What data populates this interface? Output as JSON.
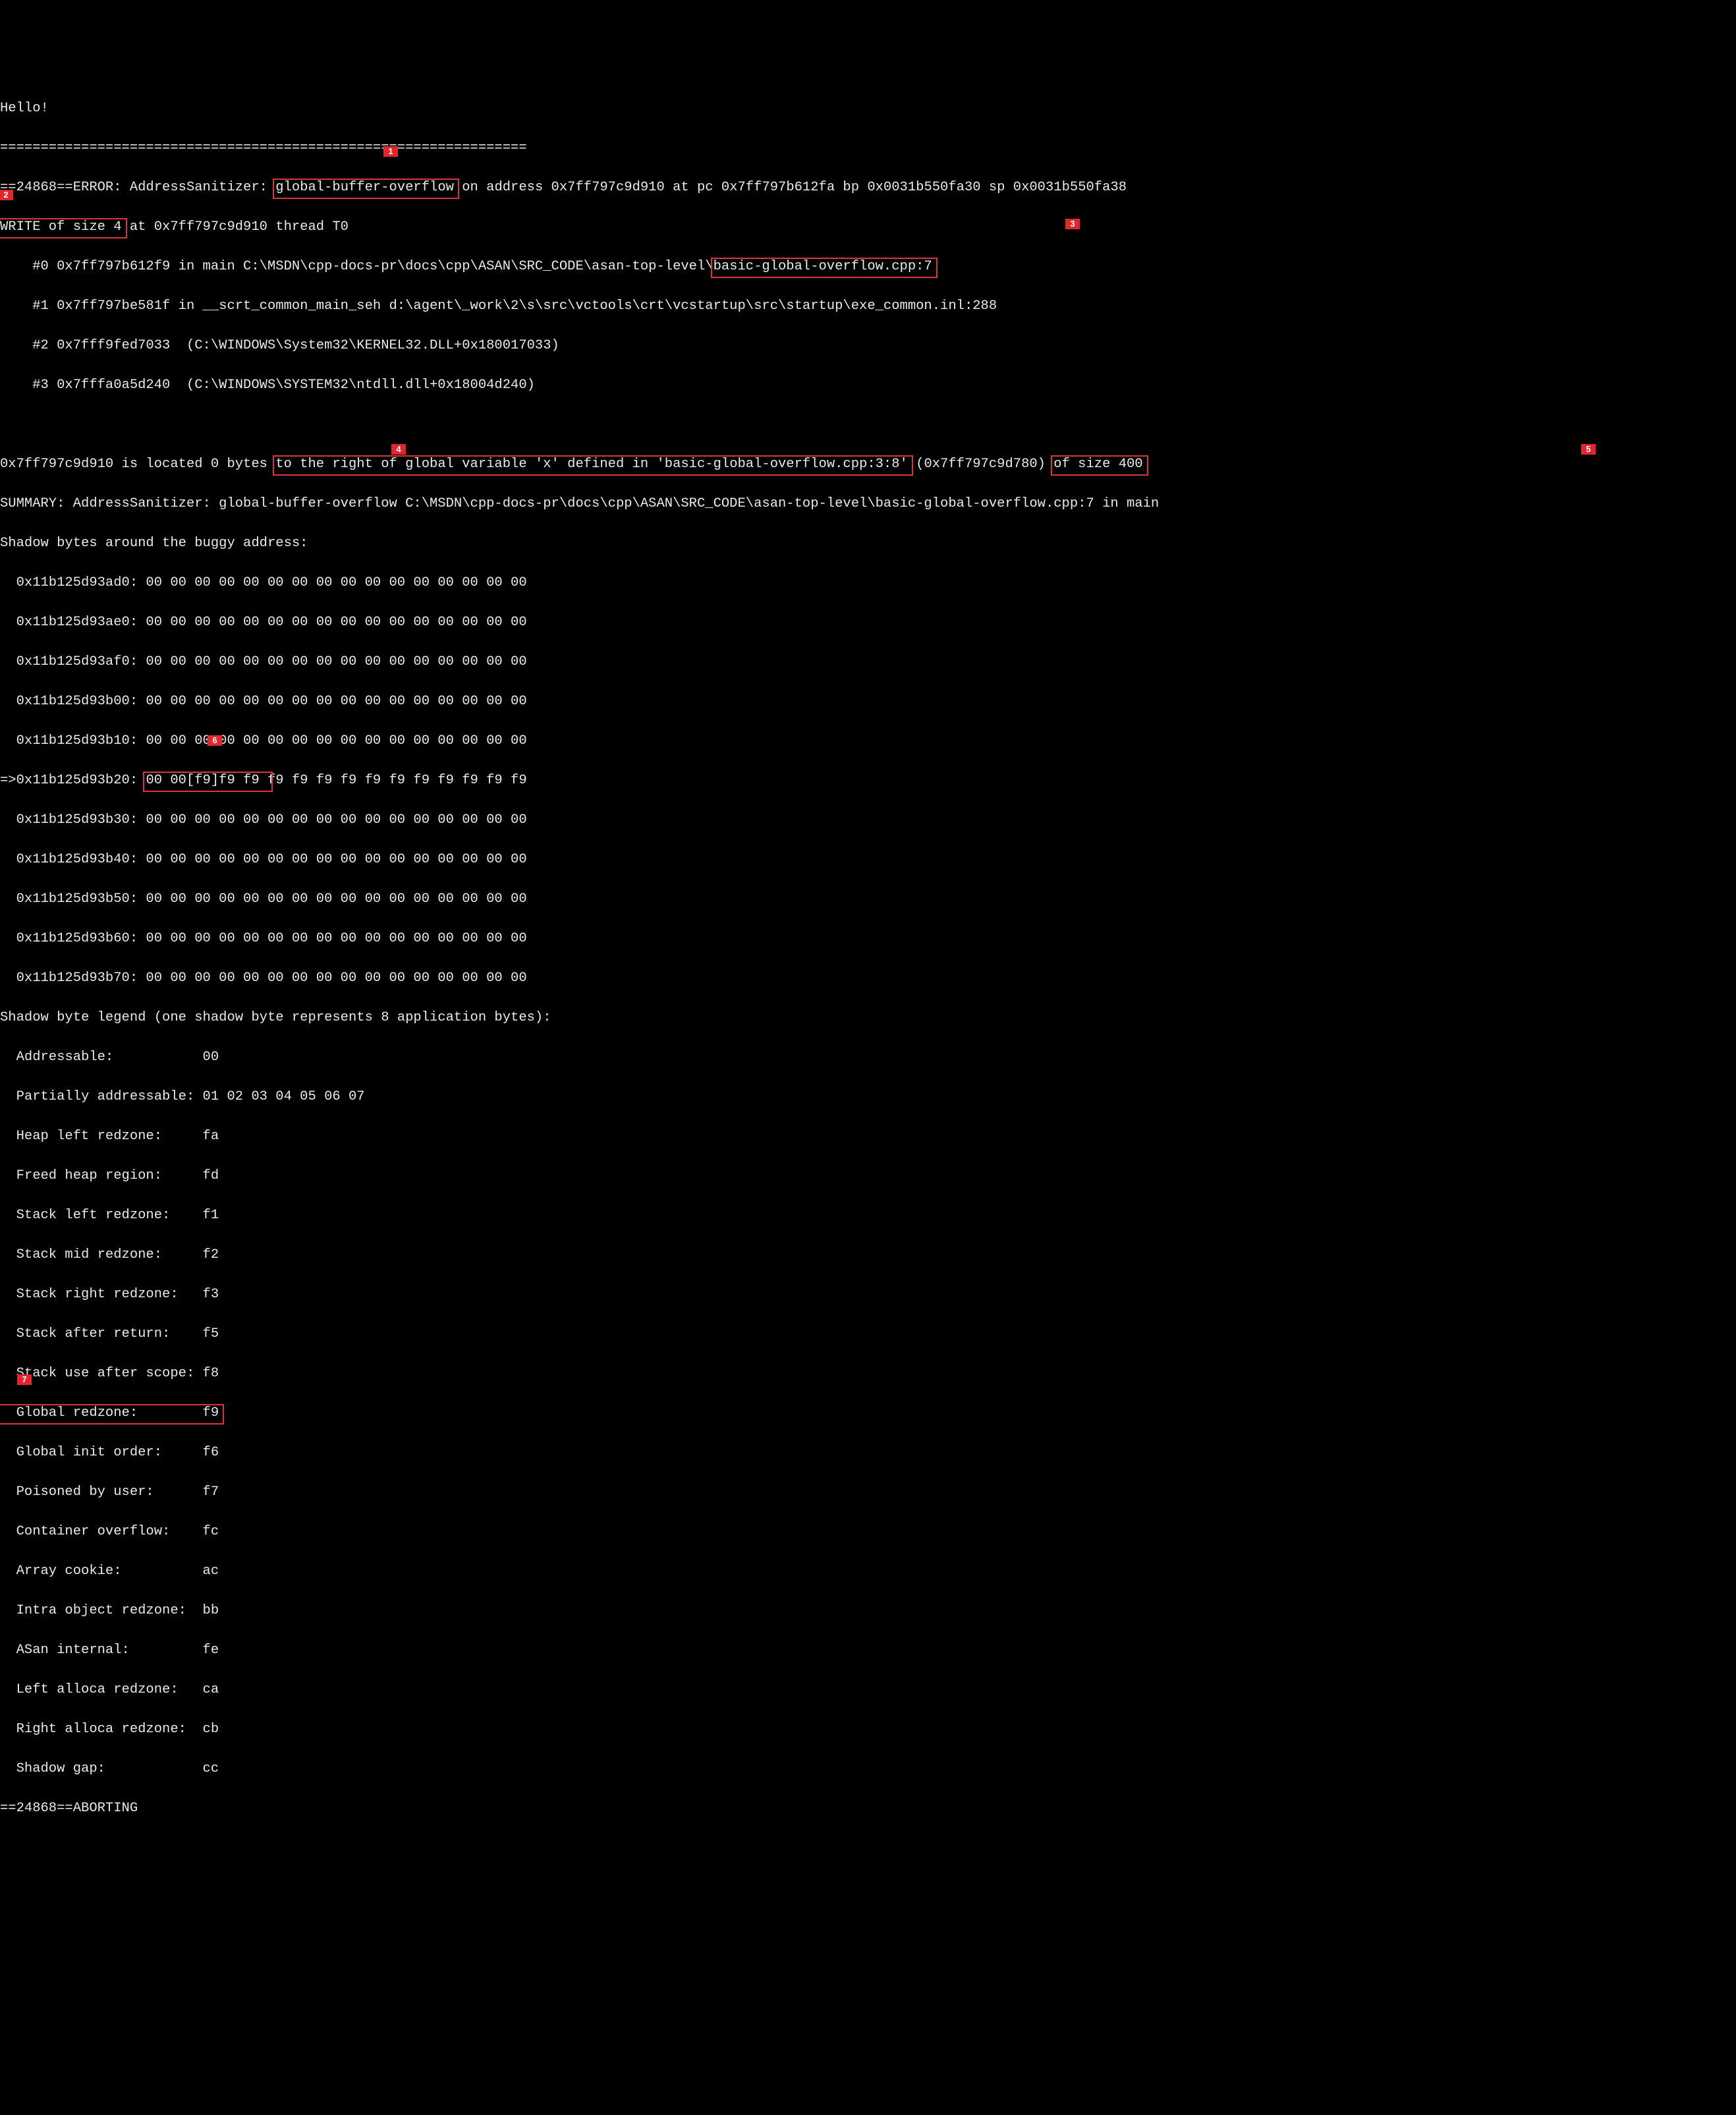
{
  "greeting": "Hello!",
  "divider": "=================================================================",
  "error": {
    "prefix": "==24868==ERROR: AddressSanitizer: ",
    "type": "global-buffer-overflow",
    "suffix": " on address 0x7ff797c9d910 at pc 0x7ff797b612fa bp 0x0031b550fa30 sp 0x0031b550fa38"
  },
  "write": {
    "prefix": "WRITE of size 4",
    "mid": " at 0x7ff797c9d910 thread T0"
  },
  "stack": {
    "f0a": "    #0 0x7ff797b612f9 in main C:\\MSDN\\cpp-docs-pr\\docs\\cpp\\ASAN\\SRC_CODE\\asan-top-level\\",
    "f0b": "basic-global-overflow.cpp:7",
    "f1": "    #1 0x7ff797be581f in __scrt_common_main_seh d:\\agent\\_work\\2\\s\\src\\vctools\\crt\\vcstartup\\src\\startup\\exe_common.inl:288",
    "f2": "    #2 0x7fff9fed7033  (C:\\WINDOWS\\System32\\KERNEL32.DLL+0x180017033)",
    "f3": "    #3 0x7fffa0a5d240  (C:\\WINDOWS\\SYSTEM32\\ntdll.dll+0x18004d240)"
  },
  "blank": "",
  "located": {
    "a": "0x7ff797c9d910 is located 0 bytes ",
    "b": "to the right of global variable 'x' defined in 'basic-global-overflow.cpp:3:8'",
    "c": " (0x7ff797c9d780) ",
    "d": "of size 400"
  },
  "summary": "SUMMARY: AddressSanitizer: global-buffer-overflow C:\\MSDN\\cpp-docs-pr\\docs\\cpp\\ASAN\\SRC_CODE\\asan-top-level\\basic-global-overflow.cpp:7 in main",
  "shadow_header": "Shadow bytes around the buggy address:",
  "shadow_rows": [
    "  0x11b125d93ad0: 00 00 00 00 00 00 00 00 00 00 00 00 00 00 00 00",
    "  0x11b125d93ae0: 00 00 00 00 00 00 00 00 00 00 00 00 00 00 00 00",
    "  0x11b125d93af0: 00 00 00 00 00 00 00 00 00 00 00 00 00 00 00 00",
    "  0x11b125d93b00: 00 00 00 00 00 00 00 00 00 00 00 00 00 00 00 00"
  ],
  "shadow_b10": {
    "a": "  0x11b125d93b10: ",
    "b": "00 00 00 00 00 00 00 00 00 00 00 00 00 00 00 00"
  },
  "shadow_b20": {
    "a": "=>0x11b125d93b20: ",
    "b": "00 00[f9]f9 f9 ",
    "c": "f9 f9 f9 f9 f9 f9 f9 f9 f9 f9 f9"
  },
  "shadow_rows2": [
    "  0x11b125d93b30: 00 00 00 00 00 00 00 00 00 00 00 00 00 00 00 00",
    "  0x11b125d93b40: 00 00 00 00 00 00 00 00 00 00 00 00 00 00 00 00",
    "  0x11b125d93b50: 00 00 00 00 00 00 00 00 00 00 00 00 00 00 00 00",
    "  0x11b125d93b60: 00 00 00 00 00 00 00 00 00 00 00 00 00 00 00 00",
    "  0x11b125d93b70: 00 00 00 00 00 00 00 00 00 00 00 00 00 00 00 00"
  ],
  "legend_header": "Shadow byte legend (one shadow byte represents 8 application bytes):",
  "legend": [
    "  Addressable:           00",
    "  Partially addressable: 01 02 03 04 05 06 07",
    "  Heap left redzone:     fa",
    "  Freed heap region:     fd",
    "  Stack left redzone:    f1",
    "  Stack mid redzone:     f2",
    "  Stack right redzone:   f3",
    "  Stack after return:    f5",
    "  Stack use after scope: f8"
  ],
  "legend_global": "  Global redzone:        f9",
  "legend2": [
    "  Global init order:     f6",
    "  Poisoned by user:      f7",
    "  Container overflow:    fc",
    "  Array cookie:          ac",
    "  Intra object redzone:  bb",
    "  ASan internal:         fe",
    "  Left alloca redzone:   ca",
    "  Right alloca redzone:  cb",
    "  Shadow gap:            cc"
  ],
  "abort": "==24868==ABORTING",
  "callouts": {
    "c1": "1",
    "c2": "2",
    "c3": "3",
    "c4": "4",
    "c5": "5",
    "c6": "6",
    "c7": "7"
  }
}
